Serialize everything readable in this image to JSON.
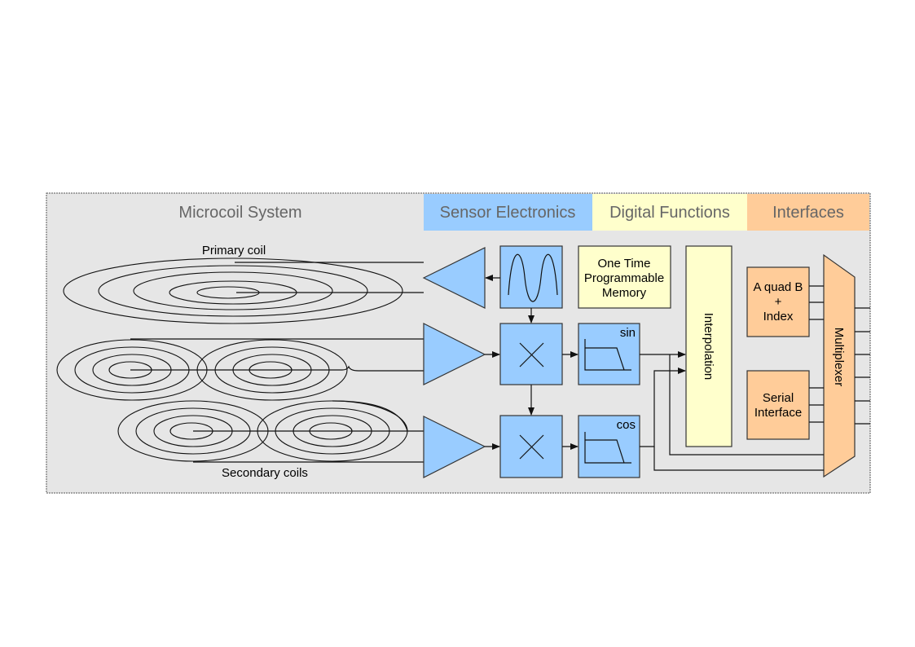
{
  "sections": {
    "microcoil": "Microcoil System",
    "sensor": "Sensor Electronics",
    "digital": "Digital Functions",
    "interfaces": "Interfaces"
  },
  "labels": {
    "primary_coil": "Primary coil",
    "secondary_coils": "Secondary coils",
    "otp_line1": "One Time",
    "otp_line2": "Programmable",
    "otp_line3": "Memory",
    "interpolation": "Interpolation",
    "aquadb_line1": "A quad B",
    "aquadb_line2": "+",
    "aquadb_line3": "Index",
    "serial_line1": "Serial",
    "serial_line2": "Interface",
    "multiplexer": "Multiplexer",
    "sin": "sin",
    "cos": "cos"
  },
  "colors": {
    "sensor": "#99ccff",
    "digital": "#ffffcc",
    "interfaces": "#ffcc99",
    "background": "#e6e6e6"
  }
}
